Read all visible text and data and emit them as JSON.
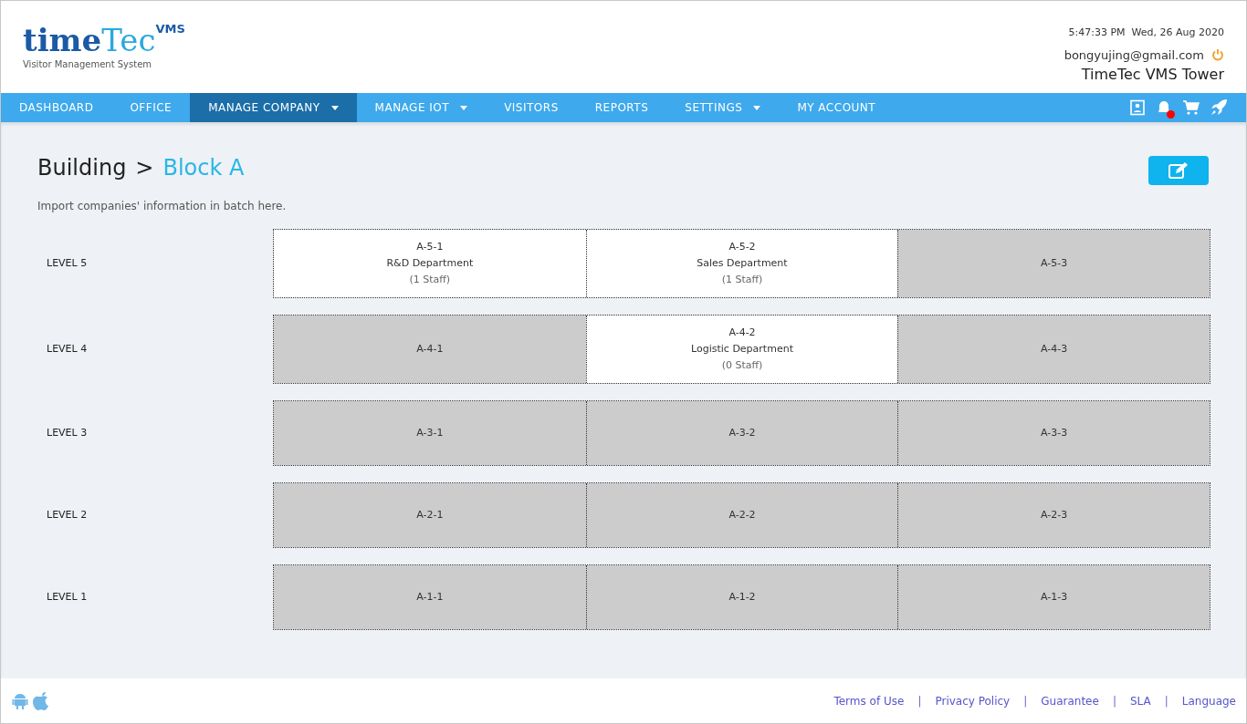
{
  "logo": {
    "word_a": "time",
    "word_b": "Tec",
    "badge": "VMS",
    "tagline": "Visitor Management System"
  },
  "header": {
    "datetime": "5:47:33 PM  Wed, 26 Aug 2020",
    "email": "bongyujing@gmail.com",
    "site": "TimeTec VMS Tower"
  },
  "nav": [
    {
      "label": "DASHBOARD",
      "selected": false,
      "dropdown": false
    },
    {
      "label": "OFFICE",
      "selected": false,
      "dropdown": false
    },
    {
      "label": "MANAGE COMPANY",
      "selected": true,
      "dropdown": true
    },
    {
      "label": "MANAGE IOT",
      "selected": false,
      "dropdown": true
    },
    {
      "label": "VISITORS",
      "selected": false,
      "dropdown": false
    },
    {
      "label": "REPORTS",
      "selected": false,
      "dropdown": false
    },
    {
      "label": "SETTINGS",
      "selected": false,
      "dropdown": true
    },
    {
      "label": "MY ACCOUNT",
      "selected": false,
      "dropdown": false
    }
  ],
  "notification_unread": true,
  "breadcrumb": {
    "parent": "Building",
    "separator": ">",
    "current": "Block A"
  },
  "subtitle": "Import companies' information in batch here.",
  "levels": [
    {
      "label": "LEVEL 5",
      "units": [
        {
          "code": "A-5-1",
          "occupied": true,
          "department": "R&D Department",
          "staff": "(1 Staff)"
        },
        {
          "code": "A-5-2",
          "occupied": true,
          "department": "Sales Department",
          "staff": "(1 Staff)"
        },
        {
          "code": "A-5-3",
          "occupied": false
        }
      ]
    },
    {
      "label": "LEVEL 4",
      "units": [
        {
          "code": "A-4-1",
          "occupied": false
        },
        {
          "code": "A-4-2",
          "occupied": true,
          "department": "Logistic Department",
          "staff": "(0 Staff)"
        },
        {
          "code": "A-4-3",
          "occupied": false
        }
      ]
    },
    {
      "label": "LEVEL 3",
      "units": [
        {
          "code": "A-3-1",
          "occupied": false
        },
        {
          "code": "A-3-2",
          "occupied": false
        },
        {
          "code": "A-3-3",
          "occupied": false
        }
      ]
    },
    {
      "label": "LEVEL 2",
      "units": [
        {
          "code": "A-2-1",
          "occupied": false
        },
        {
          "code": "A-2-2",
          "occupied": false
        },
        {
          "code": "A-2-3",
          "occupied": false
        }
      ]
    },
    {
      "label": "LEVEL 1",
      "units": [
        {
          "code": "A-1-1",
          "occupied": false
        },
        {
          "code": "A-1-2",
          "occupied": false
        },
        {
          "code": "A-1-3",
          "occupied": false
        }
      ]
    }
  ],
  "footer_links": [
    "Terms of Use",
    "Privacy Policy",
    "Guarantee",
    "SLA",
    "Language"
  ],
  "footer_separator": "|"
}
